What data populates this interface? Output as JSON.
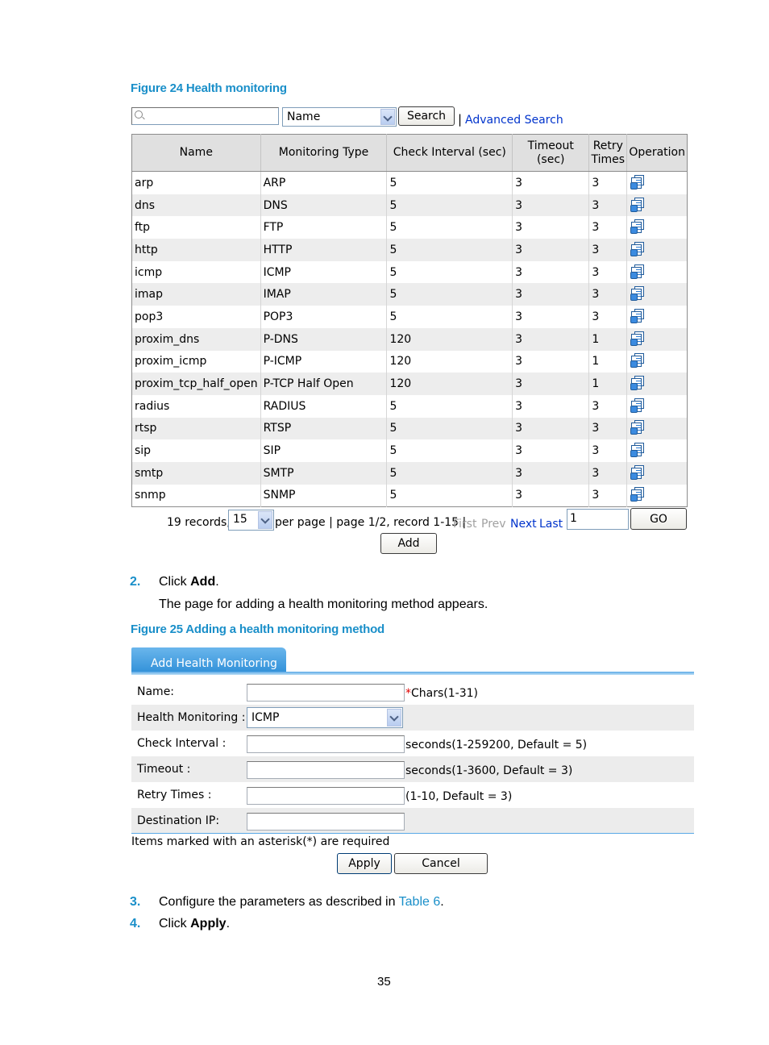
{
  "figure24": {
    "caption": "Figure 24 Health monitoring",
    "search": {
      "input_value": "",
      "field_select": "Name",
      "search_label": "Search",
      "separator": "|",
      "advanced_label": "Advanced Search"
    },
    "table": {
      "headers": [
        "Name",
        "Monitoring Type",
        "Check Interval (sec)",
        "Timeout (sec)",
        "Retry Times",
        "Operation"
      ],
      "rows": [
        [
          "arp",
          "ARP",
          "5",
          "3",
          "3"
        ],
        [
          "dns",
          "DNS",
          "5",
          "3",
          "3"
        ],
        [
          "ftp",
          "FTP",
          "5",
          "3",
          "3"
        ],
        [
          "http",
          "HTTP",
          "5",
          "3",
          "3"
        ],
        [
          "icmp",
          "ICMP",
          "5",
          "3",
          "3"
        ],
        [
          "imap",
          "IMAP",
          "5",
          "3",
          "3"
        ],
        [
          "pop3",
          "POP3",
          "5",
          "3",
          "3"
        ],
        [
          "proxim_dns",
          "P-DNS",
          "120",
          "3",
          "1"
        ],
        [
          "proxim_icmp",
          "P-ICMP",
          "120",
          "3",
          "1"
        ],
        [
          "proxim_tcp_half_open",
          "P-TCP Half Open",
          "120",
          "3",
          "1"
        ],
        [
          "radius",
          "RADIUS",
          "5",
          "3",
          "3"
        ],
        [
          "rtsp",
          "RTSP",
          "5",
          "3",
          "3"
        ],
        [
          "sip",
          "SIP",
          "5",
          "3",
          "3"
        ],
        [
          "smtp",
          "SMTP",
          "5",
          "3",
          "3"
        ],
        [
          "snmp",
          "SNMP",
          "5",
          "3",
          "3"
        ]
      ],
      "operation_icon": "modify-icon"
    },
    "pagination": {
      "records_text": "19 records,",
      "per_page_value": "15",
      "summary_text": "per page | page 1/2, record 1-15 |",
      "first": "First",
      "prev": "Prev",
      "next": "Next",
      "last": "Last",
      "page_input": "1",
      "go_label": "GO"
    },
    "add_label": "Add"
  },
  "steps_a": {
    "step2_num": "2.",
    "step2_text_pre": "Click ",
    "step2_bold": "Add",
    "step2_text_post": ".",
    "step2_desc": "The page for adding a health monitoring method appears."
  },
  "figure25": {
    "caption": "Figure 25 Adding a health monitoring method",
    "tab_label": "Add Health Monitoring",
    "fields": [
      {
        "label": "Name:",
        "value": "",
        "hint_required": "*",
        "hint": "Chars(1-31)"
      },
      {
        "label": "Health Monitoring :",
        "select_value": "ICMP"
      },
      {
        "label": "Check Interval :",
        "value": "",
        "hint": "seconds(1-259200, Default = 5)"
      },
      {
        "label": "Timeout :",
        "value": "",
        "hint": "seconds(1-3600, Default = 3)"
      },
      {
        "label": "Retry Times :",
        "value": "",
        "hint": "(1-10, Default = 3)"
      },
      {
        "label": "Destination IP:",
        "value": ""
      }
    ],
    "required_note": "Items marked with an asterisk(*) are required",
    "apply_label": "Apply",
    "cancel_label": "Cancel"
  },
  "steps_b": {
    "step3_num": "3.",
    "step3_pre": "Configure the parameters as described in ",
    "step3_link": "Table 6",
    "step3_post": ".",
    "step4_num": "4.",
    "step4_pre": "Click ",
    "step4_bold": "Apply",
    "step4_post": "."
  },
  "page_number": "35",
  "colors": {
    "caption_blue": "#1a8fc9",
    "link_blue": "#0033cc",
    "tab_blue": "#3f9be0",
    "header_gray": "#e0e0e0"
  }
}
